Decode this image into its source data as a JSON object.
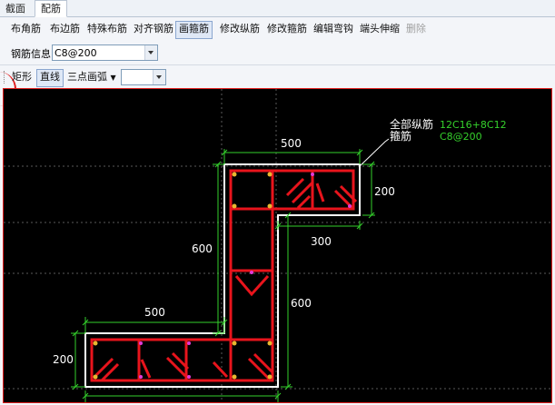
{
  "tabs": [
    {
      "label": "截面",
      "active": false
    },
    {
      "label": "配筋",
      "active": true
    }
  ],
  "toolbar1": {
    "items": [
      {
        "label": "布角筋",
        "state": "normal"
      },
      {
        "label": "布边筋",
        "state": "normal"
      },
      {
        "label": "特殊布筋",
        "state": "normal"
      },
      {
        "label": "对齐钢筋",
        "state": "normal"
      },
      {
        "label": "画箍筋",
        "state": "pressed"
      },
      {
        "label": "修改纵筋",
        "state": "normal"
      },
      {
        "label": "修改箍筋",
        "state": "normal"
      },
      {
        "label": "编辑弯钩",
        "state": "normal"
      },
      {
        "label": "端头伸缩",
        "state": "normal"
      },
      {
        "label": "删除",
        "state": "disabled"
      }
    ]
  },
  "rebar_info": {
    "label": "钢筋信息",
    "value": "C8@200"
  },
  "toolbar3": {
    "rect_label": "矩形",
    "line_label": "直线",
    "arc_label": "三点画弧",
    "extra_value": ""
  },
  "drawing": {
    "note_longitudinal_label": "全部纵筋",
    "note_longitudinal_value": "12C16+8C12",
    "note_stirrup_label": "箍筋",
    "note_stirrup_value": "C8@200",
    "dims": {
      "top_width": "500",
      "top_height": "200",
      "step_width": "300",
      "left_height": "600",
      "right_height": "600",
      "bottom_width": "500",
      "bottom_height": "200"
    },
    "colors": {
      "background": "#000000",
      "outline": "#ffffff",
      "rebar": "#e8141c",
      "dimension": "#35d12c",
      "note_value": "#35d12c",
      "text": "#ffffff",
      "rebar_point": "#e8b830"
    }
  }
}
